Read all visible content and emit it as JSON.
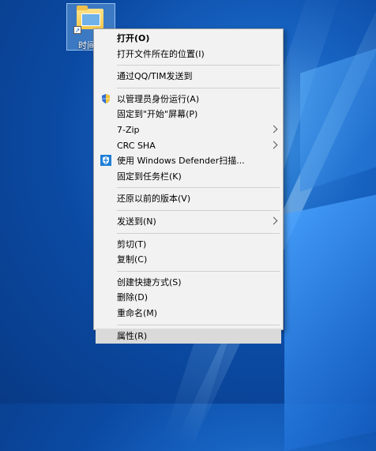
{
  "desktop": {
    "icon_label": "时间"
  },
  "menu": {
    "groups": [
      [
        {
          "label": "打开(O)",
          "bold": true
        },
        {
          "label": "打开文件所在的位置(I)"
        }
      ],
      [
        {
          "label": "通过QQ/TIM发送到"
        }
      ],
      [
        {
          "label": "以管理员身份运行(A)",
          "icon": "uac-shield-icon"
        },
        {
          "label": "固定到\"开始\"屏幕(P)"
        },
        {
          "label": "7-Zip",
          "submenu": true
        },
        {
          "label": "CRC SHA",
          "submenu": true
        },
        {
          "label": "使用 Windows Defender扫描...",
          "icon": "windows-defender-icon"
        },
        {
          "label": "固定到任务栏(K)"
        }
      ],
      [
        {
          "label": "还原以前的版本(V)"
        }
      ],
      [
        {
          "label": "发送到(N)",
          "submenu": true
        }
      ],
      [
        {
          "label": "剪切(T)"
        },
        {
          "label": "复制(C)"
        }
      ],
      [
        {
          "label": "创建快捷方式(S)"
        },
        {
          "label": "删除(D)"
        },
        {
          "label": "重命名(M)"
        }
      ],
      [
        {
          "label": "属性(R)",
          "hover": true
        }
      ]
    ]
  },
  "colors": {
    "menu_bg": "#f2f2f2",
    "hover_bg": "#dadada",
    "desktop_blue": "#0b4aa3"
  }
}
